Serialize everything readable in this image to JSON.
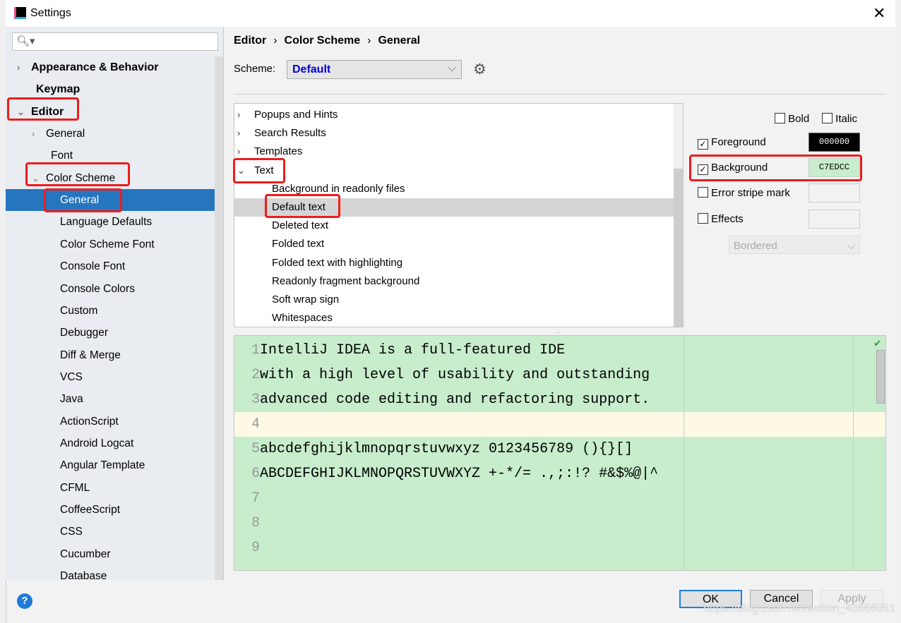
{
  "window": {
    "title": "Settings"
  },
  "sidebar": {
    "search_placeholder": "",
    "items": [
      {
        "label": "Appearance & Behavior",
        "level": 0,
        "bold": true,
        "chevron": "right"
      },
      {
        "label": "Keymap",
        "level": 0,
        "bold": true
      },
      {
        "label": "Editor",
        "level": 0,
        "bold": true,
        "chevron": "down"
      },
      {
        "label": "General",
        "level": 1,
        "chevron": "right"
      },
      {
        "label": "Font",
        "level": 1
      },
      {
        "label": "Color Scheme",
        "level": 1,
        "chevron": "down"
      },
      {
        "label": "General",
        "level": 2,
        "selected": true
      },
      {
        "label": "Language Defaults",
        "level": 2
      },
      {
        "label": "Color Scheme Font",
        "level": 2
      },
      {
        "label": "Console Font",
        "level": 2
      },
      {
        "label": "Console Colors",
        "level": 2
      },
      {
        "label": "Custom",
        "level": 2
      },
      {
        "label": "Debugger",
        "level": 2
      },
      {
        "label": "Diff & Merge",
        "level": 2
      },
      {
        "label": "VCS",
        "level": 2
      },
      {
        "label": "Java",
        "level": 2
      },
      {
        "label": "ActionScript",
        "level": 2
      },
      {
        "label": "Android Logcat",
        "level": 2
      },
      {
        "label": "Angular Template",
        "level": 2
      },
      {
        "label": "CFML",
        "level": 2
      },
      {
        "label": "CoffeeScript",
        "level": 2
      },
      {
        "label": "CSS",
        "level": 2
      },
      {
        "label": "Cucumber",
        "level": 2
      },
      {
        "label": "Database",
        "level": 2
      }
    ]
  },
  "breadcrumb": [
    "Editor",
    "Color Scheme",
    "General"
  ],
  "scheme": {
    "label": "Scheme:",
    "value": "Default"
  },
  "tree": [
    {
      "label": "Popups and Hints",
      "chevron": "right"
    },
    {
      "label": "Search Results",
      "chevron": "right"
    },
    {
      "label": "Templates",
      "chevron": "right"
    },
    {
      "label": "Text",
      "chevron": "down"
    },
    {
      "label": "Background in readonly files",
      "child": true
    },
    {
      "label": "Default text",
      "child": true,
      "selected": true
    },
    {
      "label": "Deleted text",
      "child": true
    },
    {
      "label": "Folded text",
      "child": true
    },
    {
      "label": "Folded text with highlighting",
      "child": true
    },
    {
      "label": "Readonly fragment background",
      "child": true
    },
    {
      "label": "Soft wrap sign",
      "child": true
    },
    {
      "label": "Whitespaces",
      "child": true
    }
  ],
  "attributes": {
    "bold": {
      "label": "Bold",
      "checked": false
    },
    "italic": {
      "label": "Italic",
      "checked": false
    },
    "foreground": {
      "label": "Foreground",
      "checked": true,
      "value": "000000"
    },
    "background": {
      "label": "Background",
      "checked": true,
      "value": "C7EDCC"
    },
    "error_stripe": {
      "label": "Error stripe mark",
      "checked": false
    },
    "effects": {
      "label": "Effects",
      "checked": false,
      "type": "Bordered"
    }
  },
  "preview": {
    "lines": [
      "IntelliJ IDEA is a full-featured IDE",
      "with a high level of usability and outstanding",
      "advanced code editing and refactoring support.",
      "",
      "abcdefghijklmnopqrstuvwxyz 0123456789 (){}[]",
      "ABCDEFGHIJKLMNOPQRSTUVWXYZ +-*/= .,;:!? #&$%@|^",
      "",
      "",
      ""
    ],
    "numbers": [
      "1",
      "2",
      "3",
      "4",
      "5",
      "6",
      "7",
      "8",
      "9"
    ]
  },
  "buttons": {
    "ok": "OK",
    "cancel": "Cancel",
    "apply": "Apply",
    "help": "?"
  },
  "watermark": "https://blog.csdn.net/weixin_43666051",
  "colors": {
    "selection": "#2675bf",
    "highlight": "#ee1c1c",
    "preview_bg": "#c7edcc"
  }
}
